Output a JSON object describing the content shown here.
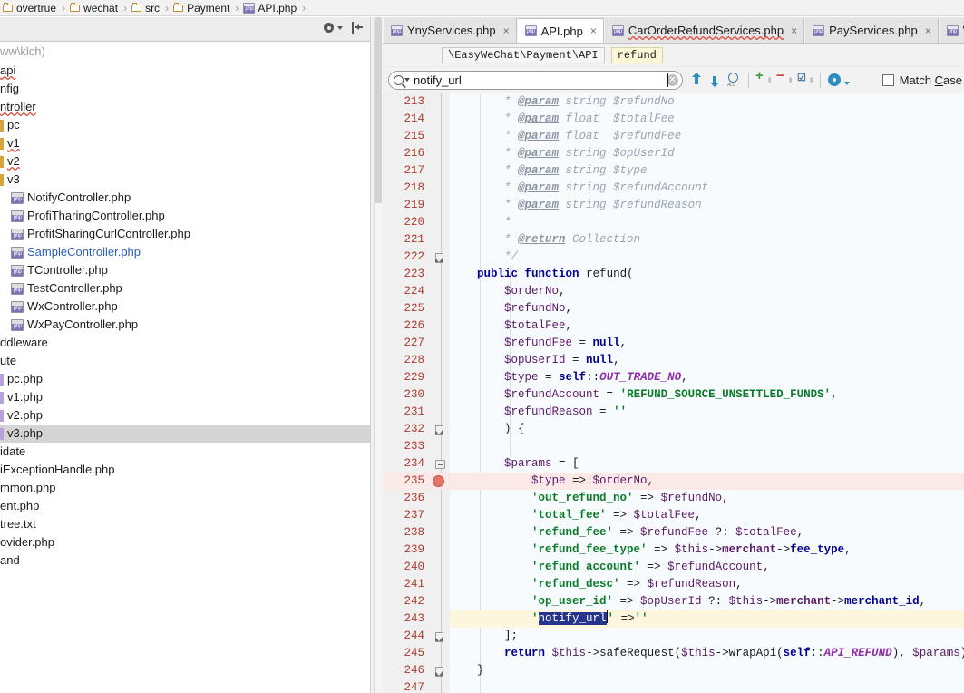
{
  "breadcrumb": {
    "items": [
      {
        "label": "overtrue",
        "icon": "folder-icon"
      },
      {
        "label": "wechat",
        "icon": "folder-icon"
      },
      {
        "label": "src",
        "icon": "folder-icon"
      },
      {
        "label": "Payment",
        "icon": "folder-icon"
      },
      {
        "label": "API.php",
        "icon": "php-file-icon"
      }
    ],
    "separator": "›"
  },
  "project_panel": {
    "toolbar": {
      "settings_icon": "gear-icon",
      "collapse_icon": "collapse-all-icon"
    },
    "header_text": "ww\\klch)",
    "items": [
      {
        "label": "api",
        "type": "folder",
        "squiggle": true,
        "indent": 0,
        "color": "dark"
      },
      {
        "label": "nfig",
        "type": "folder",
        "squiggle": false,
        "indent": 0,
        "color": "dark"
      },
      {
        "label": "ntroller",
        "type": "folder",
        "squiggle": true,
        "indent": 0,
        "color": "dark"
      },
      {
        "label": "pc",
        "type": "bar-amber",
        "squiggle": false,
        "indent": 0,
        "color": "dark"
      },
      {
        "label": "v1",
        "type": "bar-amber",
        "squiggle": true,
        "indent": 0,
        "color": "dark"
      },
      {
        "label": "v2",
        "type": "bar-amber",
        "squiggle": true,
        "indent": 0,
        "color": "dark"
      },
      {
        "label": "v3",
        "type": "bar-amber",
        "squiggle": false,
        "indent": 0,
        "color": "dark"
      },
      {
        "label": "NotifyController.php",
        "type": "php",
        "squiggle": false,
        "indent": 1,
        "color": "dark"
      },
      {
        "label": "ProfiTharingController.php",
        "type": "php",
        "squiggle": false,
        "indent": 1,
        "color": "dark"
      },
      {
        "label": "ProfitSharingCurlController.php",
        "type": "php",
        "squiggle": false,
        "indent": 1,
        "color": "dark"
      },
      {
        "label": "SampleController.php",
        "type": "php",
        "squiggle": false,
        "indent": 1,
        "color": "blue"
      },
      {
        "label": "TController.php",
        "type": "php",
        "squiggle": false,
        "indent": 1,
        "color": "dark"
      },
      {
        "label": "TestController.php",
        "type": "php",
        "squiggle": false,
        "indent": 1,
        "color": "dark"
      },
      {
        "label": "WxController.php",
        "type": "php",
        "squiggle": false,
        "indent": 1,
        "color": "dark"
      },
      {
        "label": "WxPayController.php",
        "type": "php",
        "squiggle": false,
        "indent": 1,
        "color": "dark"
      },
      {
        "label": "ddleware",
        "type": "folder",
        "squiggle": false,
        "indent": 0,
        "color": "dark"
      },
      {
        "label": "ute",
        "type": "folder",
        "squiggle": false,
        "indent": 0,
        "color": "dark"
      },
      {
        "label": "pc.php",
        "type": "bar",
        "squiggle": false,
        "indent": 0,
        "color": "dark"
      },
      {
        "label": "v1.php",
        "type": "bar",
        "squiggle": false,
        "indent": 0,
        "color": "dark"
      },
      {
        "label": "v2.php",
        "type": "bar",
        "squiggle": false,
        "indent": 0,
        "color": "dark"
      },
      {
        "label": "v3.php",
        "type": "bar",
        "squiggle": false,
        "indent": 0,
        "color": "dark",
        "selected": true
      },
      {
        "label": "idate",
        "type": "folder",
        "squiggle": false,
        "indent": 0,
        "color": "dark"
      },
      {
        "label": "iExceptionHandle.php",
        "type": "folder",
        "squiggle": false,
        "indent": 0,
        "color": "dark"
      },
      {
        "label": "mmon.php",
        "type": "folder",
        "squiggle": false,
        "indent": 0,
        "color": "dark"
      },
      {
        "label": "ent.php",
        "type": "folder",
        "squiggle": false,
        "indent": 0,
        "color": "dark"
      },
      {
        "label": "tree.txt",
        "type": "folder",
        "squiggle": false,
        "indent": 0,
        "color": "dark"
      },
      {
        "label": "ovider.php",
        "type": "folder",
        "squiggle": false,
        "indent": 0,
        "color": "dark"
      },
      {
        "label": "and",
        "type": "folder",
        "squiggle": false,
        "indent": 0,
        "color": "dark"
      }
    ]
  },
  "editor": {
    "tabs": [
      {
        "label": "YnyServices.php",
        "active": false,
        "squiggle": false,
        "close": "×"
      },
      {
        "label": "API.php",
        "active": true,
        "squiggle": false,
        "close": "×"
      },
      {
        "label": "CarOrderRefundServices.php",
        "active": false,
        "squiggle": true,
        "close": "×"
      },
      {
        "label": "PayServices.php",
        "active": false,
        "squiggle": false,
        "close": "×"
      },
      {
        "label": "W",
        "active": false,
        "squiggle": false,
        "close": ""
      }
    ],
    "navbar": {
      "namespace": "\\EasyWeChat\\Payment\\API",
      "member": "refund"
    },
    "find": {
      "query": "notify_url",
      "search_icon": "search-icon",
      "dropdown_icon": "chevron-down-icon",
      "clear_icon": "clear-icon",
      "prev_icon": "arrow-up-icon",
      "next_icon": "arrow-down-icon",
      "find_all_icon": "find-all-icon",
      "add_cursor_icon": "add-selection-icon",
      "remove_cursor_icon": "remove-selection-icon",
      "select_all_icon": "select-all-occurrences-icon",
      "settings_icon": "gear-icon",
      "match_case_label": "Match Case",
      "match_case_mnemonic": "C",
      "match_case_checked": false
    },
    "code": {
      "first_line": 213,
      "lines": [
        {
          "n": 213,
          "fold": "",
          "mark": "",
          "html": "        <span class=\"cm\">* </span><span class=\"cm-tag\">@param</span><span class=\"cm\"> string $refundNo</span>"
        },
        {
          "n": 214,
          "fold": "",
          "mark": "",
          "html": "        <span class=\"cm\">* </span><span class=\"cm-tag\">@param</span><span class=\"cm\"> float  $totalFee</span>"
        },
        {
          "n": 215,
          "fold": "",
          "mark": "",
          "html": "        <span class=\"cm\">* </span><span class=\"cm-tag\">@param</span><span class=\"cm\"> float  $refundFee</span>"
        },
        {
          "n": 216,
          "fold": "",
          "mark": "",
          "html": "        <span class=\"cm\">* </span><span class=\"cm-tag\">@param</span><span class=\"cm\"> string $opUserId</span>"
        },
        {
          "n": 217,
          "fold": "",
          "mark": "",
          "html": "        <span class=\"cm\">* </span><span class=\"cm-tag\">@param</span><span class=\"cm\"> string $type</span>"
        },
        {
          "n": 218,
          "fold": "",
          "mark": "",
          "html": "        <span class=\"cm\">* </span><span class=\"cm-tag\">@param</span><span class=\"cm\"> string $refundAccount</span>"
        },
        {
          "n": 219,
          "fold": "",
          "mark": "",
          "html": "        <span class=\"cm\">* </span><span class=\"cm-tag\">@param</span><span class=\"cm\"> string $refundReason</span>"
        },
        {
          "n": 220,
          "fold": "",
          "mark": "",
          "html": "        <span class=\"cm\">*</span>"
        },
        {
          "n": 221,
          "fold": "",
          "mark": "",
          "html": "        <span class=\"cm\">* </span><span class=\"cm-tag\">@return</span><span class=\"cm\"> Collection</span>"
        },
        {
          "n": 222,
          "fold": "end",
          "mark": "",
          "html": "        <span class=\"cm\">*/</span>"
        },
        {
          "n": 223,
          "fold": "",
          "mark": "",
          "html": "    <span class=\"kw\">public function</span> <span class=\"fn\">refund(</span>"
        },
        {
          "n": 224,
          "fold": "",
          "mark": "",
          "html": "        <span class=\"var\">$orderNo</span><span class=\"plain\">,</span>"
        },
        {
          "n": 225,
          "fold": "",
          "mark": "",
          "html": "        <span class=\"var\">$refundNo</span><span class=\"plain\">,</span>"
        },
        {
          "n": 226,
          "fold": "",
          "mark": "",
          "html": "        <span class=\"var\">$totalFee</span><span class=\"plain\">,</span>"
        },
        {
          "n": 227,
          "fold": "",
          "mark": "",
          "html": "        <span class=\"var\">$refundFee</span><span class=\"plain\"> = </span><span class=\"kw\">null</span><span class=\"plain\">,</span>"
        },
        {
          "n": 228,
          "fold": "",
          "mark": "",
          "html": "        <span class=\"var\">$opUserId</span><span class=\"plain\"> = </span><span class=\"kw\">null</span><span class=\"plain\">,</span>"
        },
        {
          "n": 229,
          "fold": "",
          "mark": "",
          "html": "        <span class=\"var\">$type</span><span class=\"plain\"> = </span><span class=\"kw\">self</span><span class=\"plain\">::</span><span class=\"const\">OUT_TRADE_NO</span><span class=\"plain\">,</span>"
        },
        {
          "n": 230,
          "fold": "",
          "mark": "",
          "html": "        <span class=\"var\">$refundAccount</span><span class=\"plain\"> = </span><span class=\"str\">'REFUND_SOURCE_UNSETTLED_FUNDS'</span><span class=\"plain\">,</span>"
        },
        {
          "n": 231,
          "fold": "",
          "mark": "",
          "html": "        <span class=\"var\">$refundReason</span><span class=\"plain\"> = </span><span class=\"str\">''</span>"
        },
        {
          "n": 232,
          "fold": "end",
          "mark": "",
          "html": "        <span class=\"plain\">) {</span>"
        },
        {
          "n": 233,
          "fold": "",
          "mark": "",
          "html": ""
        },
        {
          "n": 234,
          "fold": "start",
          "mark": "",
          "html": "        <span class=\"var\">$params</span><span class=\"plain\"> = [</span>"
        },
        {
          "n": 235,
          "fold": "",
          "mark": "breakpoint",
          "hl": "red",
          "html": "            <span class=\"var\">$type</span><span class=\"plain\"> =&gt; </span><span class=\"var\">$orderNo</span><span class=\"plain\">,</span>"
        },
        {
          "n": 236,
          "fold": "",
          "mark": "",
          "html": "            <span class=\"str\">'out_refund_no'</span><span class=\"plain\"> =&gt; </span><span class=\"var\">$refundNo</span><span class=\"plain\">,</span>"
        },
        {
          "n": 237,
          "fold": "",
          "mark": "",
          "html": "            <span class=\"str\">'total_fee'</span><span class=\"plain\"> =&gt; </span><span class=\"var\">$totalFee</span><span class=\"plain\">,</span>"
        },
        {
          "n": 238,
          "fold": "",
          "mark": "",
          "html": "            <span class=\"str\">'refund_fee'</span><span class=\"plain\"> =&gt; </span><span class=\"var\">$refundFee</span><span class=\"plain\"> ?: </span><span class=\"var\">$totalFee</span><span class=\"plain\">,</span>"
        },
        {
          "n": 239,
          "fold": "",
          "mark": "",
          "html": "            <span class=\"str\">'refund_fee_type'</span><span class=\"plain\"> =&gt; </span><span class=\"var\">$this</span><span class=\"plain\">-&gt;</span><span class=\"prop\">merchant</span><span class=\"plain\">-&gt;</span><span class=\"prop2\">fee_type</span><span class=\"plain\">,</span>"
        },
        {
          "n": 240,
          "fold": "",
          "mark": "",
          "html": "            <span class=\"str\">'refund_account'</span><span class=\"plain\"> =&gt; </span><span class=\"var\">$refundAccount</span><span class=\"plain\">,</span>"
        },
        {
          "n": 241,
          "fold": "",
          "mark": "",
          "html": "            <span class=\"str\">'refund_desc'</span><span class=\"plain\"> =&gt; </span><span class=\"var\">$refundReason</span><span class=\"plain\">,</span>"
        },
        {
          "n": 242,
          "fold": "",
          "mark": "",
          "html": "            <span class=\"str\">'op_user_id'</span><span class=\"plain\"> =&gt; </span><span class=\"var\">$opUserId</span><span class=\"plain\"> ?: </span><span class=\"var\">$this</span><span class=\"plain\">-&gt;</span><span class=\"prop\">merchant</span><span class=\"plain\">-&gt;</span><span class=\"prop2\">merchant_id</span><span class=\"plain\">,</span>"
        },
        {
          "n": 243,
          "fold": "",
          "mark": "",
          "hl": "yellow",
          "html": "            <span class=\"str\">'</span><span class=\"selhl\">notify_url</span><span class=\"caretbar\"></span><span class=\"str\">'</span><span class=\"plain\"> =&gt;</span><span class=\"str\">''</span>"
        },
        {
          "n": 244,
          "fold": "end",
          "mark": "",
          "html": "        <span class=\"plain\">];</span>"
        },
        {
          "n": 245,
          "fold": "",
          "mark": "",
          "html": "        <span class=\"kw\">return</span> <span class=\"var\">$this</span><span class=\"plain\">-&gt;</span><span class=\"fn\">safeRequest(</span><span class=\"var\">$this</span><span class=\"plain\">-&gt;</span><span class=\"fn\">wrapApi(</span><span class=\"kw\">self</span><span class=\"plain\">::</span><span class=\"const\">API_REFUND</span><span class=\"fn\">)</span><span class=\"plain\">, </span><span class=\"var\">$params</span><span class=\"fn\">);</span>"
        },
        {
          "n": 246,
          "fold": "end",
          "mark": "",
          "html": "    <span class=\"plain\">}</span>"
        },
        {
          "n": 247,
          "fold": "",
          "mark": "",
          "html": ""
        }
      ]
    }
  },
  "colors": {
    "accent": "#2a8fc0",
    "breakpoint": "#e1756a",
    "selection": "#26348c",
    "string": "#0a7a28",
    "keyword": "#00008f",
    "constant": "#8f2fa8",
    "line_number": "#b03a2e",
    "highlight_red": "#fbe9e7",
    "highlight_yellow": "#fdf6dd",
    "code_bg": "#f8fbfe",
    "tree_selected": "#d4d4d4"
  }
}
